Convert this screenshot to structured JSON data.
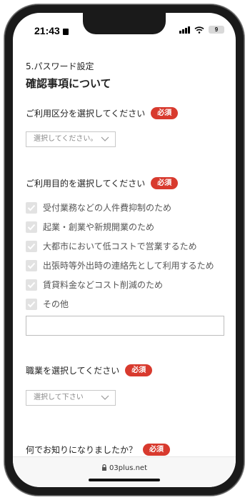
{
  "status": {
    "time": "21:43",
    "battery": "9"
  },
  "form": {
    "section_number": "5.パスワード設定",
    "title": "確認事項について",
    "required_badge": "必須",
    "usage_type": {
      "label": "ご利用区分を選択してください",
      "placeholder": "選択してください。"
    },
    "purpose": {
      "label": "ご利用目的を選択してください",
      "options": [
        "受付業務などの人件費抑制のため",
        "起業・創業や新規開業のため",
        "大都市において低コストで営業するため",
        "出張時等外出時の連絡先として利用するため",
        "賃貸料金などコスト削減のため",
        "その他"
      ],
      "other_text": ""
    },
    "occupation": {
      "label": "職業を選択してください",
      "placeholder": "選択して下さい"
    },
    "referral": {
      "label": "何でお知りになりましたか？"
    }
  },
  "browser": {
    "url": "03plus.net"
  },
  "colors": {
    "badge": "#d83a2e",
    "checkbox": "#e2e2e2"
  }
}
